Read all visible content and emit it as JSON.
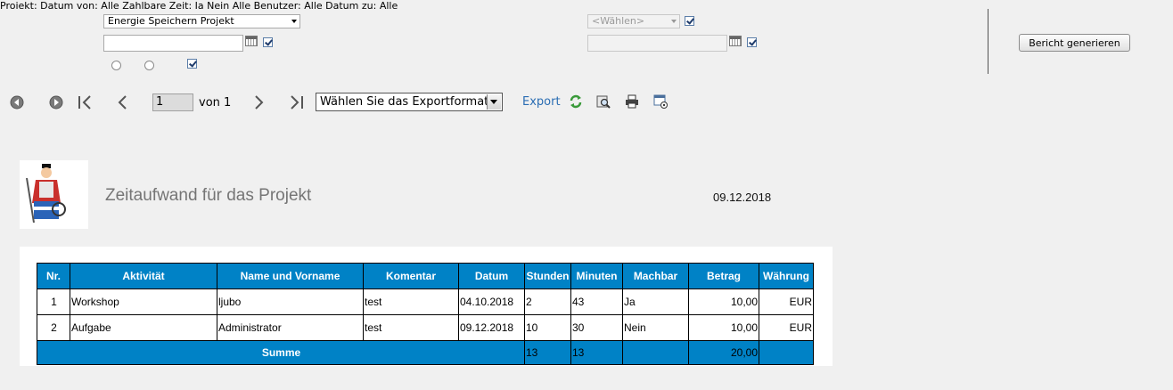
{
  "filters": {
    "projekt_label": "Projekt:",
    "projekt_value": "Energie Speichern Projekt",
    "datum_von_label": "Datum von:",
    "datum_von_value": "",
    "zahlbare_zeit_label": "Zahlbare Zeit:",
    "radio_ja": "Ja",
    "radio_nein": "Nein",
    "alle": "Alle",
    "benutzer_label": "Benutzer:",
    "benutzer_placeholder": "<Wählen>",
    "datum_zu_label": "Datum zu:",
    "datum_zu_value": "",
    "generate_button": "Bericht generieren"
  },
  "toolbar": {
    "page_current": "1",
    "page_of": "von 1",
    "export_format": "Wählen Sie das Exportformat",
    "export_link": "Export"
  },
  "report": {
    "title": "Zeitaufwand für das Projekt",
    "date": "09.12.2018",
    "columns": [
      "Nr.",
      "Aktivität",
      "Name und Vorname",
      "Komentar",
      "Datum",
      "Stunden",
      "Minuten",
      "Machbar",
      "Betrag",
      "Währung"
    ],
    "rows": [
      {
        "nr": "1",
        "aktivitaet": "Workshop",
        "name": "ljubo",
        "komentar": "test",
        "datum": "04.10.2018",
        "stunden": "2",
        "minuten": "43",
        "machbar": "Ja",
        "betrag": "10,00",
        "waehrung": "EUR"
      },
      {
        "nr": "2",
        "aktivitaet": "Aufgabe",
        "name": "Administrator",
        "komentar": "test",
        "datum": "09.12.2018",
        "stunden": "10",
        "minuten": "30",
        "machbar": "Nein",
        "betrag": "10,00",
        "waehrung": "EUR"
      }
    ],
    "summary": {
      "label": "Summe",
      "stunden": "13",
      "minuten": "13",
      "betrag": "20,00"
    }
  },
  "colors": {
    "header_blue": "#0082c6",
    "link_blue": "#2a6db3"
  }
}
